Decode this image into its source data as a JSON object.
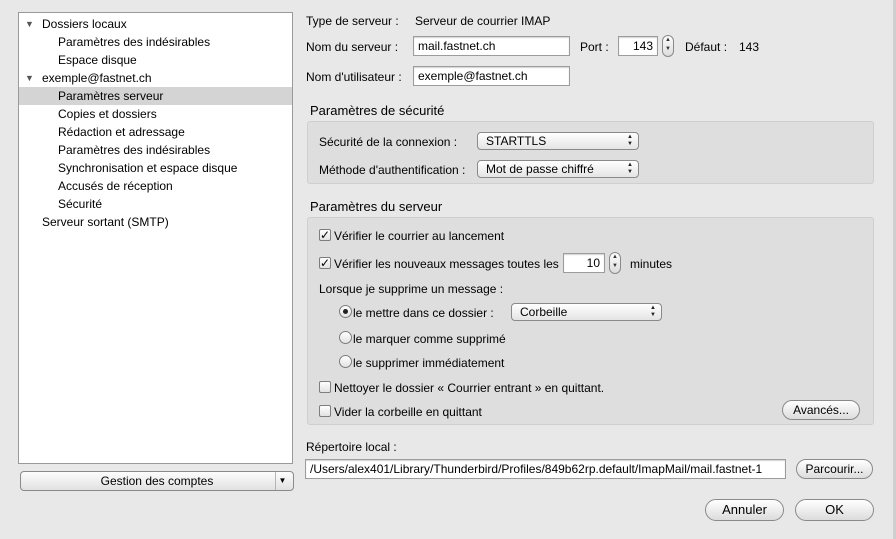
{
  "sidebar": {
    "items": [
      {
        "label": "Dossiers locaux",
        "expanded": true
      },
      {
        "label": "Paramètres des indésirables"
      },
      {
        "label": "Espace disque"
      },
      {
        "label": "exemple@fastnet.ch",
        "expanded": true
      },
      {
        "label": "Paramètres serveur",
        "selected": true
      },
      {
        "label": "Copies et dossiers"
      },
      {
        "label": "Rédaction et adressage"
      },
      {
        "label": "Paramètres des indésirables"
      },
      {
        "label": "Synchronisation et espace disque"
      },
      {
        "label": "Accusés de réception"
      },
      {
        "label": "Sécurité"
      },
      {
        "label": "Serveur sortant (SMTP)"
      }
    ],
    "manage_accounts": "Gestion des comptes"
  },
  "server": {
    "type_label": "Type de serveur :",
    "type_value": "Serveur de courrier IMAP",
    "name_label": "Nom du serveur :",
    "name_value": "mail.fastnet.ch",
    "port_label": "Port :",
    "port_value": "143",
    "default_label": "Défaut :",
    "default_value": "143",
    "user_label": "Nom d'utilisateur :",
    "user_value": "exemple@fastnet.ch"
  },
  "security": {
    "title": "Paramètres de sécurité",
    "connection_label": "Sécurité de la connexion :",
    "connection_value": "STARTTLS",
    "auth_label": "Méthode d'authentification :",
    "auth_value": "Mot de passe chiffré"
  },
  "server_settings": {
    "title": "Paramètres du serveur",
    "check_startup": "Vérifier le courrier au lancement",
    "check_startup_checked": true,
    "check_every": "Vérifier les nouveaux messages toutes les",
    "check_every_checked": true,
    "minutes_value": "10",
    "minutes_label": "minutes",
    "delete_label": "Lorsque je supprime un message :",
    "radio_move": "le mettre dans ce dossier :",
    "radio_move_selected": true,
    "folder_value": "Corbeille",
    "radio_mark": "le marquer comme supprimé",
    "radio_delete": "le supprimer immédiatement",
    "clean_inbox": "Nettoyer le dossier « Courrier entrant » en quittant.",
    "clean_inbox_checked": false,
    "empty_trash": "Vider la corbeille en quittant",
    "empty_trash_checked": false,
    "advanced_button": "Avancés..."
  },
  "local": {
    "label": "Répertoire local :",
    "path": "/Users/alex401/Library/Thunderbird/Profiles/849b62rp.default/ImapMail/mail.fastnet-1",
    "browse_button": "Parcourir..."
  },
  "footer": {
    "cancel": "Annuler",
    "ok": "OK"
  }
}
